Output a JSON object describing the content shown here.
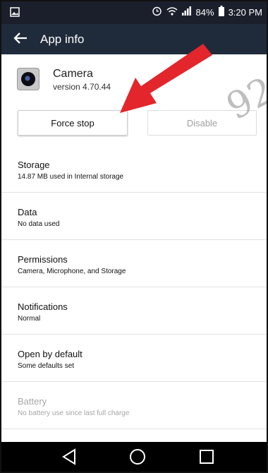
{
  "status_bar": {
    "battery_percent": "84%",
    "time": "3:20 PM",
    "icons": [
      "gallery-icon",
      "alarm-icon",
      "wifi-icon",
      "signal-icon",
      "battery-icon"
    ]
  },
  "app_bar": {
    "title": "App info",
    "back_icon": "back-arrow-icon"
  },
  "app": {
    "name": "Camera",
    "version": "version 4.70.44",
    "icon": "camera-app-icon"
  },
  "buttons": {
    "force_stop": "Force stop",
    "disable": "Disable"
  },
  "list": [
    {
      "title": "Storage",
      "subtitle": "14.87 MB used in Internal storage",
      "enabled": true
    },
    {
      "title": "Data",
      "subtitle": "No data used",
      "enabled": true
    },
    {
      "title": "Permissions",
      "subtitle": "Camera, Microphone, and Storage",
      "enabled": true
    },
    {
      "title": "Notifications",
      "subtitle": "Normal",
      "enabled": true
    },
    {
      "title": "Open by default",
      "subtitle": "Some defaults set",
      "enabled": true
    },
    {
      "title": "Battery",
      "subtitle": "No battery use since last full charge",
      "enabled": false
    }
  ],
  "nav_bar": {
    "icons": [
      "back-triangle-icon",
      "home-circle-icon",
      "recents-square-icon"
    ]
  },
  "watermark": "92",
  "colors": {
    "status_bar": "#1a1f2b",
    "app_bar": "#1f2b3b",
    "arrow": "#e3262b",
    "disabled_text": "#a6a6a6"
  }
}
